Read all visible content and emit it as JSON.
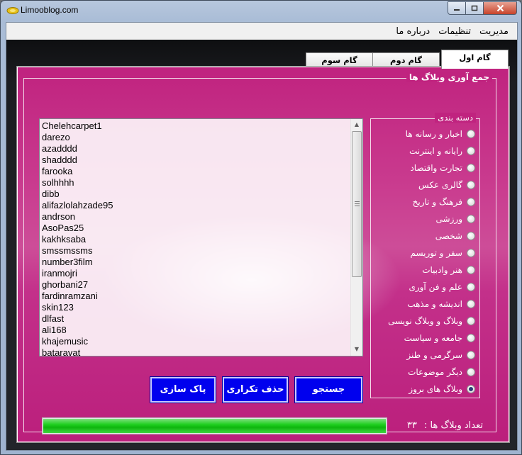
{
  "window": {
    "title": "Limooblog.com"
  },
  "menu": [
    "مدیریت",
    "تنظیمات",
    "درباره ما"
  ],
  "tabs": [
    {
      "label": "گام اول",
      "active": true
    },
    {
      "label": "گام دوم",
      "active": false
    },
    {
      "label": "گام سوم",
      "active": false
    }
  ],
  "group": {
    "title": "جمع آوری وبلاگ ها"
  },
  "weblogs": [
    "Chelehcarpet1",
    "darezo",
    "azadddd",
    "shadddd",
    "farooka",
    "solhhhh",
    "dibb",
    "alifazlolahzade95",
    "andrson",
    "AsoPas25",
    "kakhksaba",
    "smssmssms",
    "number3film",
    "iranmojri",
    "ghorbani27",
    "fardinramzani",
    "skin123",
    "dlfast",
    "ali168",
    "khajemusic",
    "bataravat"
  ],
  "categories": {
    "title": "دسته بندی",
    "items": [
      {
        "label": "اخبار و رسانه ها",
        "checked": false
      },
      {
        "label": "رایانه و اینترنت",
        "checked": false
      },
      {
        "label": "تجارت واقتصاد",
        "checked": false
      },
      {
        "label": "گالری عکس",
        "checked": false
      },
      {
        "label": "فرهنگ و تاریخ",
        "checked": false
      },
      {
        "label": "ورزشی",
        "checked": false
      },
      {
        "label": "شخصی",
        "checked": false
      },
      {
        "label": "سفر و توریسم",
        "checked": false
      },
      {
        "label": "هنر وادبیات",
        "checked": false
      },
      {
        "label": "علم و فن آوری",
        "checked": false
      },
      {
        "label": "اندیشه و مذهب",
        "checked": false
      },
      {
        "label": "وبلاگ و وبلاگ نویسی",
        "checked": false
      },
      {
        "label": "جامعه و سیاست",
        "checked": false
      },
      {
        "label": "سرگرمی و طنز",
        "checked": false
      },
      {
        "label": "دیگر موضوعات",
        "checked": false
      },
      {
        "label": "وبلاگ های بروز",
        "checked": true
      }
    ]
  },
  "buttons": {
    "search": "جستجو",
    "remove_duplicates": "حذف تکراری",
    "clear": "پاک سازی"
  },
  "status": {
    "count_label": "تعداد وبلاگ ها :",
    "count_value": "۳۳",
    "progress": 1.0
  },
  "colors": {
    "panel": "#c0237f",
    "button": "#0000ee",
    "progress": "#1fcf1f"
  }
}
